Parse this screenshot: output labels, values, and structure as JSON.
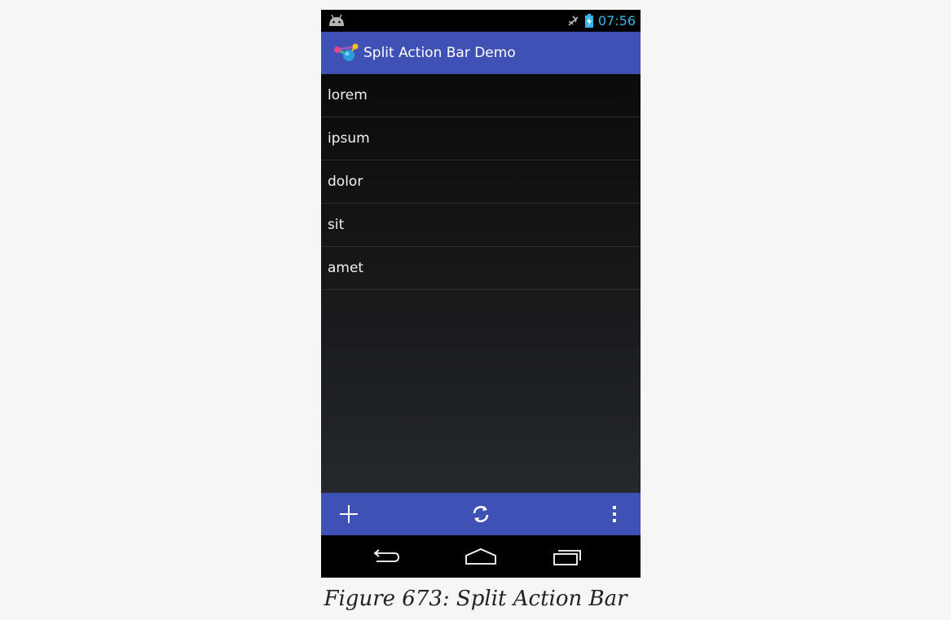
{
  "status_bar": {
    "time": "07:56",
    "icons": [
      "android-icon",
      "airplane-mode-icon",
      "battery-charging-icon"
    ]
  },
  "action_bar": {
    "title": "Split Action Bar Demo",
    "icon": "app-icon",
    "color": "#3f51b5"
  },
  "list": {
    "items": [
      "lorem",
      "ipsum",
      "dolor",
      "sit",
      "amet"
    ]
  },
  "split_action_bar": {
    "actions": [
      "add-icon",
      "refresh-icon",
      "overflow-menu-icon"
    ]
  },
  "nav_bar": {
    "buttons": [
      "back-icon",
      "home-icon",
      "recents-icon"
    ]
  },
  "caption": {
    "text": "Figure 673: Split Action Bar"
  },
  "colors": {
    "accent": "#3f51b5",
    "status_time": "#33b5e5",
    "page_background": "#f6f6f6"
  }
}
